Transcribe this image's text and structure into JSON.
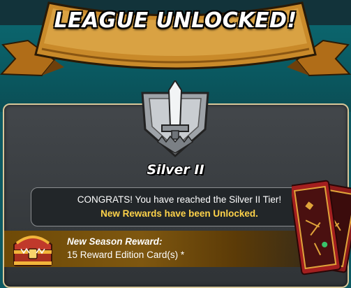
{
  "banner": {
    "title": "LEAGUE UNLOCKED!"
  },
  "tier": {
    "name": "Silver II",
    "emblem_icon": "silver-league-shield-sword-icon"
  },
  "message": {
    "line1": "CONGRATS! You have reached the Silver II Tier!",
    "line2": "New Rewards have been Unlocked."
  },
  "reward": {
    "icon": "treasure-chest-icon",
    "title": "New Season Reward:",
    "value": "15 Reward Edition Card(s) *"
  },
  "colors": {
    "banner_gold": "#c98a2a",
    "highlight_yellow": "#ffd34a",
    "panel_border": "#d8c89a",
    "teal_background": "#0c6b73"
  }
}
